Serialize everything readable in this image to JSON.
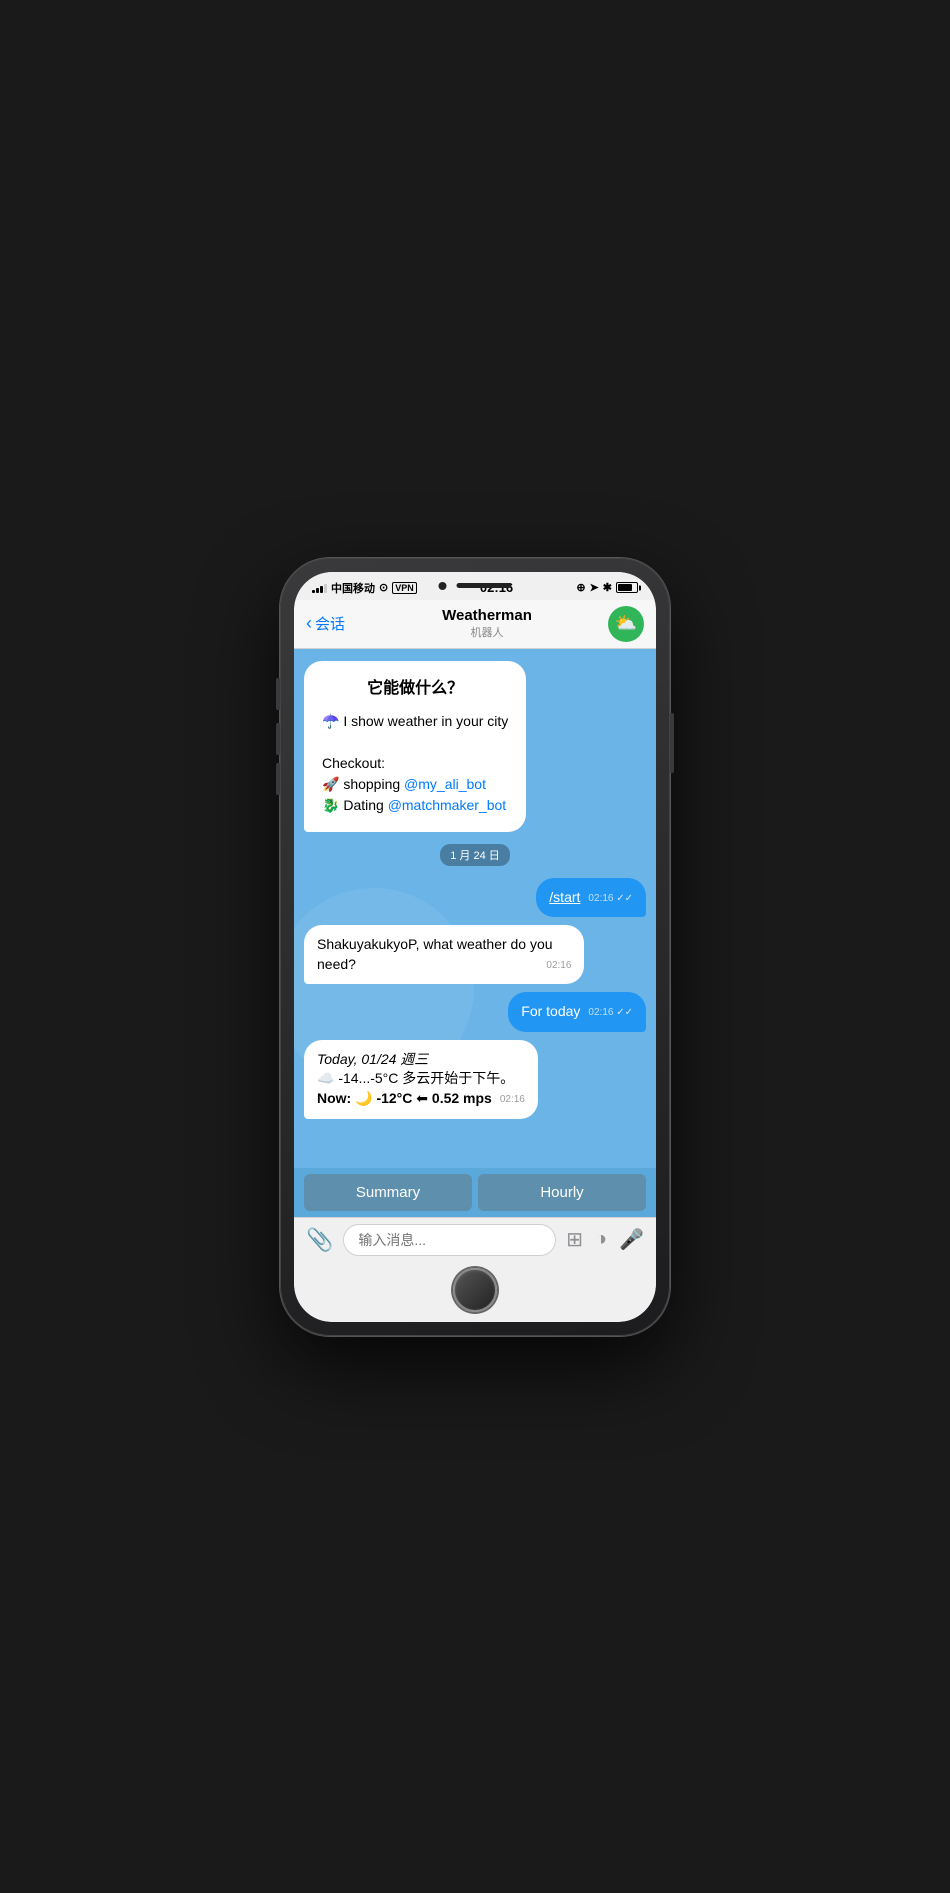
{
  "phone": {
    "status_bar": {
      "carrier": "中国移动",
      "wifi_icon": "wifi",
      "vpn_label": "VPN",
      "time": "02:16",
      "lock_icon": "🔒",
      "location_icon": "➤",
      "bluetooth_icon": "✱",
      "battery_pct": 80
    },
    "nav": {
      "back_label": "会话",
      "title": "Weatherman",
      "subtitle": "机器人"
    },
    "chat": {
      "intro_title": "它能做什么？",
      "intro_line1_emoji": "☂️",
      "intro_line1_text": " I show weather in your city",
      "intro_checkout": "Checkout:",
      "intro_shopping_emoji": "🚀",
      "intro_shopping_text": " shopping ",
      "intro_shopping_link": "@my_ali_bot",
      "intro_dating_emoji": "🐉",
      "intro_dating_text": " Dating ",
      "intro_dating_link": "@matchmaker_bot",
      "date_badge": "1 月 24 日",
      "user_msg1": "/start",
      "user_msg1_time": "02:16",
      "bot_reply1": "ShakuyakukyoP, what weather do you need?",
      "bot_reply1_time": "02:16",
      "user_msg2": "For today",
      "user_msg2_time": "02:16",
      "bot_reply2_date": "Today, 01/24 週三",
      "bot_reply2_temp": "☁️ -14...-5°C 多云开始于下午。",
      "bot_reply2_now_label": "Now:",
      "bot_reply2_now_moon": "🌙",
      "bot_reply2_now_temp": "-12°C",
      "bot_reply2_now_arrow": "⬅",
      "bot_reply2_now_wind": "0.52 mps",
      "bot_reply2_time": "02:16",
      "quick_reply_summary": "Summary",
      "quick_reply_hourly": "Hourly",
      "input_placeholder": "输入消息..."
    }
  }
}
